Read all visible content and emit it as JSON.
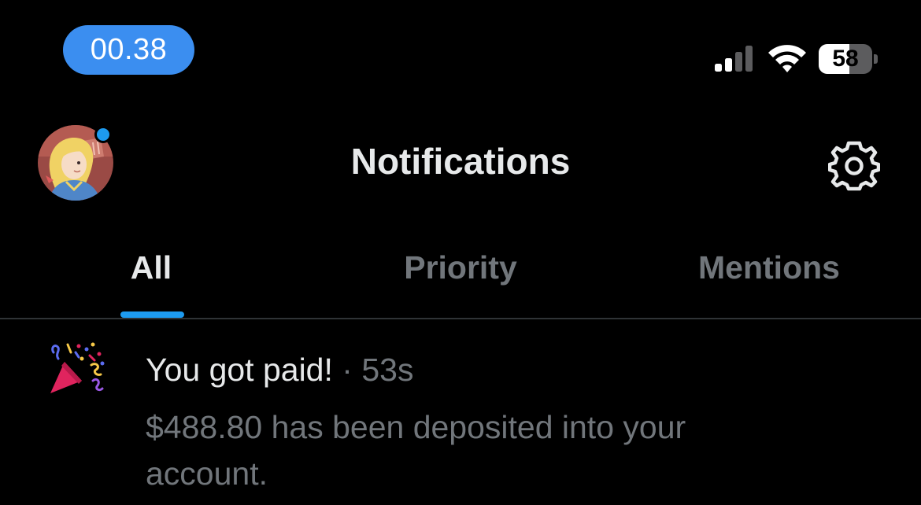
{
  "status_bar": {
    "time": "00.38",
    "battery_level": "58",
    "battery_fraction": 0.58,
    "signal_bars_active": 2,
    "icons": [
      "signal-icon",
      "wifi-icon",
      "battery-icon"
    ]
  },
  "header": {
    "title": "Notifications",
    "avatar_icon": "avatar",
    "settings_icon": "gear-icon"
  },
  "tabs": [
    {
      "label": "All",
      "selected": true
    },
    {
      "label": "Priority",
      "selected": false
    },
    {
      "label": "Mentions",
      "selected": false
    }
  ],
  "notifications": [
    {
      "icon": "party-popper-icon",
      "title": "You got paid!",
      "separator": "·",
      "time": "53s",
      "body": "$488.80 has been deposited into your account."
    }
  ],
  "colors": {
    "background": "#000000",
    "accent": "#1d9bf0",
    "time_pill": "#3b8ef0",
    "text_primary": "#e7e9ea",
    "text_secondary": "#71767b",
    "divider": "#2f3336"
  }
}
